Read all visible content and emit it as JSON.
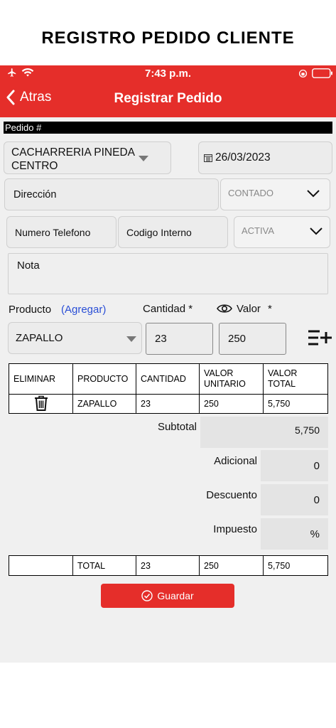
{
  "page_heading": "REGISTRO PEDIDO CLIENTE",
  "status_bar": {
    "time": "7:43 p.m.",
    "icons": [
      "airplane-icon",
      "wifi-icon",
      "orientation-lock-icon",
      "battery-icon"
    ]
  },
  "nav": {
    "back_label": "Atras",
    "title": "Registrar Pedido"
  },
  "pedido_label": "Pedido #",
  "client_select": {
    "line1": "CACHARRERIA PINEDA",
    "line2": "CENTRO"
  },
  "date": "26/03/2023",
  "direccion_placeholder": "Dirección",
  "payment_select": "CONTADO",
  "telefono_placeholder": "Numero Telefono",
  "codigo_placeholder": "Codigo Interno",
  "status_select": "ACTIVA",
  "nota_placeholder": "Nota",
  "product_row": {
    "producto_label": "Producto",
    "agregar_link": "(Agregar)",
    "cantidad_label": "Cantidad *",
    "valor_label": "Valor",
    "valor_required": "*",
    "product_value": "ZAPALLO",
    "cantidad_value": "23",
    "valor_value": "250"
  },
  "table": {
    "headers": [
      "ELIMINAR",
      "PRODUCTO",
      "CANTIDAD",
      "VALOR UNITARIO",
      "VALOR TOTAL"
    ],
    "rows": [
      {
        "producto": "ZAPALLO",
        "cantidad": "23",
        "valor_unitario": "250",
        "valor_total": "5,750"
      }
    ]
  },
  "summary": {
    "subtotal_label": "Subtotal",
    "subtotal_value": "5,750",
    "adicional_label": "Adicional",
    "adicional_value": "0",
    "descuento_label": "Descuento",
    "descuento_value": "0",
    "impuesto_label": "Impuesto",
    "impuesto_value": "%"
  },
  "totals": {
    "label": "TOTAL",
    "cantidad": "23",
    "valor_unitario": "250",
    "valor_total": "5,750"
  },
  "save_button": "Guardar",
  "colors": {
    "accent": "#e52e2a",
    "link": "#2a4fd6"
  }
}
